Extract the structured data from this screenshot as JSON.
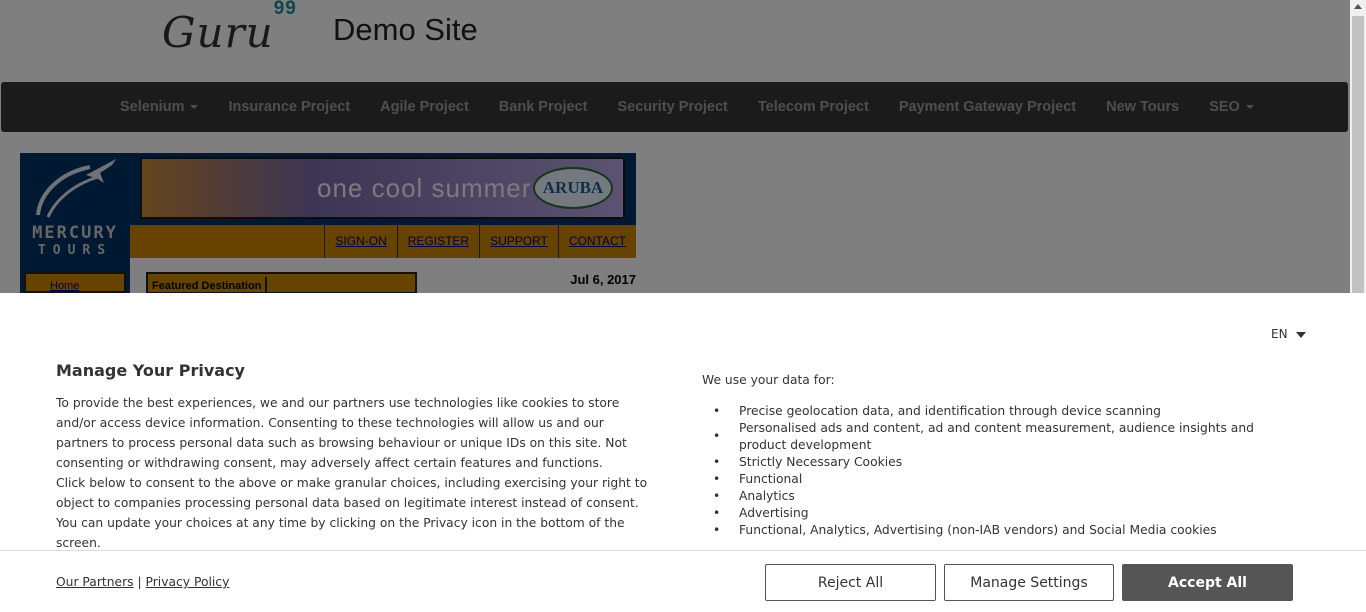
{
  "site": {
    "logo_text": "Guru",
    "logo_sup": "99",
    "title": "Demo Site"
  },
  "topnav": {
    "items": [
      {
        "label": "Selenium",
        "dropdown": true
      },
      {
        "label": "Insurance Project"
      },
      {
        "label": "Agile Project"
      },
      {
        "label": "Bank Project"
      },
      {
        "label": "Security Project"
      },
      {
        "label": "Telecom Project"
      },
      {
        "label": "Payment Gateway Project"
      },
      {
        "label": "New Tours"
      },
      {
        "label": "SEO",
        "dropdown": true
      }
    ]
  },
  "mercury": {
    "brand_line1": "MERCURY",
    "brand_line2": "TOURS",
    "banner_text": "one cool summer",
    "banner_badge": "ARUBA",
    "links": [
      "SIGN-ON",
      "REGISTER",
      "SUPPORT",
      "CONTACT"
    ],
    "side_home": "Home",
    "featured": "Featured Destination",
    "date": "Jul 6, 2017"
  },
  "privacy": {
    "language": "EN",
    "title": "Manage Your Privacy",
    "body_p1": "To provide the best experiences, we and our partners use technologies like cookies to store and/or access device information. Consenting to these technologies will allow us and our partners to process personal data such as browsing behaviour or unique IDs on this site. Not consenting or withdrawing consent, may adversely affect certain features and functions.",
    "body_p2": "Click below to consent to the above or make granular choices, including exercising your right to object to companies processing personal data based on legitimate interest instead of consent. You can update your choices at any time by clicking on the Privacy icon in the bottom of the screen.",
    "uses_title": "We use your data for:",
    "uses": [
      "Precise geolocation data, and identification through device scanning",
      "Personalised ads and content, ad and content measurement, audience insights and product development",
      "Strictly Necessary Cookies",
      "Functional",
      "Analytics",
      "Advertising",
      "Functional, Analytics, Advertising (non-IAB vendors) and Social Media cookies"
    ],
    "partners_link": "Our Partners",
    "separator": "|",
    "policy_link": "Privacy Policy",
    "reject_label": "Reject All",
    "manage_label": "Manage Settings",
    "accept_label": "Accept All"
  }
}
